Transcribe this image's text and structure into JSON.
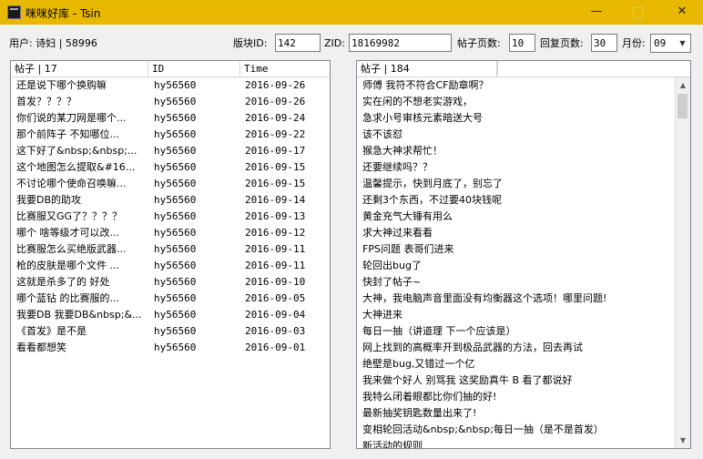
{
  "window": {
    "title": "咪咪好库 - Tsin",
    "minimize_glyph": "—",
    "close_glyph": "✕"
  },
  "toolbar": {
    "user_label": "用户: 诗妇 | 58996",
    "board_id_label": "版块ID:",
    "board_id_value": "142",
    "zid_label": "ZID:",
    "zid_value": "18169982",
    "post_pages_label": "帖子页数:",
    "post_pages_value": "10",
    "reply_pages_label": "回复页数:",
    "reply_pages_value": "30",
    "month_label": "月份:",
    "month_value": "09"
  },
  "left_list": {
    "columns": [
      "帖子 | 17",
      "ID",
      "Time"
    ],
    "rows": [
      [
        "还是说下哪个换购嘛",
        "hy56560",
        "2016-09-26"
      ],
      [
        "首发？？？？",
        "hy56560",
        "2016-09-26"
      ],
      [
        "你们说的某刀网是哪个...",
        "hy56560",
        "2016-09-24"
      ],
      [
        "那个前阵子 不知哪位...",
        "hy56560",
        "2016-09-22"
      ],
      [
        "这下好了&nbsp;&nbsp;...",
        "hy56560",
        "2016-09-17"
      ],
      [
        "这个地图怎么提取&#16...",
        "hy56560",
        "2016-09-15"
      ],
      [
        "不讨论哪个使命召唤嘛...",
        "hy56560",
        "2016-09-15"
      ],
      [
        "我要DB的助攻",
        "hy56560",
        "2016-09-14"
      ],
      [
        "比赛服又GG了？？？？",
        "hy56560",
        "2016-09-13"
      ],
      [
        "哪个 啥等级才可以改...",
        "hy56560",
        "2016-09-12"
      ],
      [
        "比赛服怎么买绝版武器...",
        "hy56560",
        "2016-09-11"
      ],
      [
        "枪的皮肤是哪个文件 ...",
        "hy56560",
        "2016-09-11"
      ],
      [
        "这就是杀多了的 好处",
        "hy56560",
        "2016-09-10"
      ],
      [
        "哪个蓝钻 的比赛服的...",
        "hy56560",
        "2016-09-05"
      ],
      [
        "我要DB 我要DB&nbsp;&...",
        "hy56560",
        "2016-09-04"
      ],
      [
        "《首发》是不是",
        "hy56560",
        "2016-09-03"
      ],
      [
        "看看都想笑",
        "hy56560",
        "2016-09-01"
      ]
    ]
  },
  "right_list": {
    "column": "帖子 | 184",
    "rows": [
      "师傅 我符不符合CF励章啊？",
      "实在闲的不想老实游戏，",
      "急求小号审核元素暗送大号",
      "该不该怼",
      "猴急大神求帮忙！",
      "还要继续吗？？",
      "温馨提示，快到月底了，别忘了",
      "还剩3个东西，不过要40块钱呢",
      "黄金充气大锤有用么",
      "求大神过来看看",
      "FPS问题 表哥们进来",
      "轮回出bug了",
      "快封了帖子~",
      "大神，我电脑声音里面没有均衡器这个选项！哪里问题!",
      "大神进来",
      "每日一抽（讲道理 下一个应该是）",
      "网上找到的高概率开到极品武器的方法，回去再试",
      "绝壁是bug,又错过一个亿",
      "我来做个好人 别骂我 这奖励真牛 B 看了都说好",
      "我特么闭着眼都比你们抽的好!",
      "最新抽奖钥匙数量出来了!",
      "变相轮回活动&nbsp;&nbsp;每日一抽（是不是首发）",
      "新活动的规则"
    ]
  }
}
